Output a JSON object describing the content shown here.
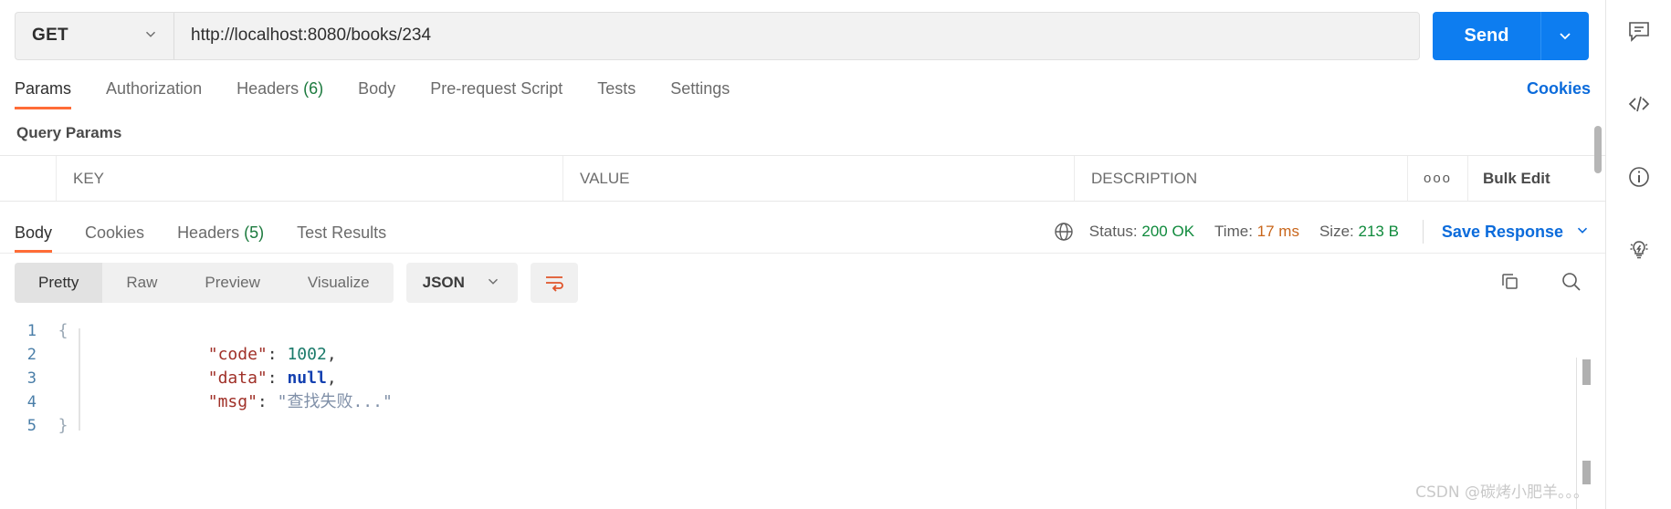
{
  "request": {
    "method": "GET",
    "url": "http://localhost:8080/books/234",
    "send_label": "Send",
    "caret": "⌄",
    "method_caret": "⌄"
  },
  "request_tabs": [
    {
      "label": "Params",
      "count": "",
      "active": true
    },
    {
      "label": "Authorization",
      "count": "",
      "active": false
    },
    {
      "label": "Headers",
      "count": "(6)",
      "active": false
    },
    {
      "label": "Body",
      "count": "",
      "active": false
    },
    {
      "label": "Pre-request Script",
      "count": "",
      "active": false
    },
    {
      "label": "Tests",
      "count": "",
      "active": false
    },
    {
      "label": "Settings",
      "count": "",
      "active": false
    }
  ],
  "cookies_link": "Cookies",
  "query_params": {
    "title": "Query Params",
    "columns": {
      "key": "KEY",
      "value": "VALUE",
      "description": "DESCRIPTION"
    },
    "options_icon": "ooo",
    "bulk_edit": "Bulk Edit",
    "rows": []
  },
  "response_tabs": [
    {
      "label": "Body",
      "count": "",
      "active": true
    },
    {
      "label": "Cookies",
      "count": "",
      "active": false
    },
    {
      "label": "Headers",
      "count": "(5)",
      "active": false
    },
    {
      "label": "Test Results",
      "count": "",
      "active": false
    }
  ],
  "response_status": {
    "status_label": "Status:",
    "status_value": "200 OK",
    "time_label": "Time:",
    "time_value": "17 ms",
    "size_label": "Size:",
    "size_value": "213 B",
    "save_response": "Save Response",
    "save_caret": "⌄"
  },
  "format_bar": {
    "modes": [
      {
        "label": "Pretty",
        "active": true
      },
      {
        "label": "Raw",
        "active": false
      },
      {
        "label": "Preview",
        "active": false
      },
      {
        "label": "Visualize",
        "active": false
      }
    ],
    "language": "JSON",
    "language_caret": "⌄"
  },
  "body": {
    "lines": [
      {
        "num": "1",
        "fold": "{",
        "indent": 0,
        "segments": [
          {
            "t": "{",
            "c": "k-punc"
          }
        ],
        "show_brace": true
      },
      {
        "num": "2",
        "fold": "",
        "indent": 1,
        "segments": [
          {
            "t": "\"code\"",
            "c": "k-key"
          },
          {
            "t": ": ",
            "c": "k-punc"
          },
          {
            "t": "1002",
            "c": "k-num"
          },
          {
            "t": ",",
            "c": "k-punc"
          }
        ]
      },
      {
        "num": "3",
        "fold": "",
        "indent": 1,
        "segments": [
          {
            "t": "\"data\"",
            "c": "k-key"
          },
          {
            "t": ": ",
            "c": "k-punc"
          },
          {
            "t": "null",
            "c": "k-null"
          },
          {
            "t": ",",
            "c": "k-punc"
          }
        ]
      },
      {
        "num": "4",
        "fold": "",
        "indent": 1,
        "segments": [
          {
            "t": "\"msg\"",
            "c": "k-key"
          },
          {
            "t": ": ",
            "c": "k-punc"
          },
          {
            "t": "\"查找失败...\"",
            "c": "k-str"
          }
        ]
      },
      {
        "num": "5",
        "fold": "}",
        "indent": 0,
        "segments": [
          {
            "t": "}",
            "c": "k-punc"
          }
        ],
        "show_brace": true
      }
    ],
    "raw_text": "{\n    \"code\": 1002,\n    \"data\": null,\n    \"msg\": \"查找失败...\"\n}"
  },
  "icons": {
    "copy": "copy-icon",
    "search": "search-icon",
    "globe": "globe-icon",
    "wrap": "word-wrap-icon",
    "rail": [
      "comment-icon",
      "code-icon",
      "info-icon",
      "bolt-bulb-icon"
    ]
  },
  "watermark": "CSDN @碳烤小肥羊。。。",
  "colors": {
    "accent_orange": "#ff6c37",
    "link_blue": "#0b6bdb",
    "send_blue": "#0d7df0",
    "status_green": "#0f8a3c",
    "json_key": "#a03028",
    "json_number": "#1a7a6a",
    "json_null": "#1340b0",
    "json_string": "#8090a8"
  }
}
